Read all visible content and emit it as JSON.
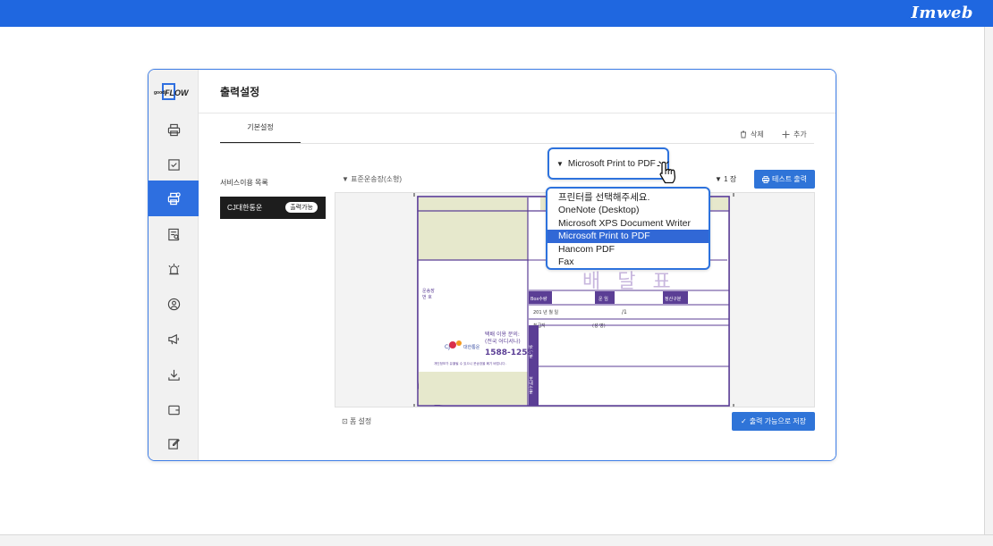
{
  "brand": "Imweb",
  "sidebar": {
    "logo_small": "goods",
    "logo_text": "FLOW",
    "items": [
      {
        "name": "printer",
        "active": false
      },
      {
        "name": "crop",
        "active": false
      },
      {
        "name": "print-settings",
        "active": true
      },
      {
        "name": "document-search",
        "active": false
      },
      {
        "name": "alarm",
        "active": false
      },
      {
        "name": "user",
        "active": false
      },
      {
        "name": "megaphone",
        "active": false
      },
      {
        "name": "download",
        "active": false
      },
      {
        "name": "wallet",
        "active": false
      },
      {
        "name": "edit",
        "active": false
      }
    ]
  },
  "page": {
    "title": "출력설정"
  },
  "tabs": [
    {
      "label": "기본설정"
    }
  ],
  "actions": {
    "delete_label": "삭제",
    "add_label": "추가"
  },
  "service": {
    "label": "서비스이용 목록",
    "items": [
      {
        "name": "CJ대한통운",
        "badge": "출력가능"
      }
    ]
  },
  "preview": {
    "label": "표준운송장(소형)",
    "copies": "1 장",
    "test_print": "테스트 출력",
    "form_settings": "폼 설정",
    "save": "출력 가능으로 저장"
  },
  "printer": {
    "selected": "Microsoft Print to PDF",
    "options": [
      "프린터를 선택해주세요.",
      "OneNote (Desktop)",
      "Microsoft XPS Document Writer",
      "Microsoft Print to PDF",
      "Hancom PDF",
      "Fax"
    ],
    "selected_index": 3
  },
  "label_doc": {
    "title_chars": "배 달 표",
    "field_ship_no": "운송장",
    "field_ship_no2": "번 호",
    "box_qty": "Box수량",
    "freight": "운 임",
    "payment": "정산구분",
    "date": "201   년    월    일",
    "sign_mark": "/1",
    "handler": "취급자",
    "sig": "(성 명)",
    "brand_name": "대한통운",
    "brand_logo_text": "CJ",
    "call_label": "택배 이용 문의:",
    "call_sub": "(전국 어디서나)",
    "phone": "1588-1255",
    "notice": "개인정보가 유출될 수 있으니 운송장을 폐기 바랍니다.",
    "recv_label": "받는분",
    "send_label": "보내는분"
  },
  "colors": {
    "accent": "#2f74d8",
    "topbar": "#1f67e0",
    "waybill": "#5b3e95"
  }
}
